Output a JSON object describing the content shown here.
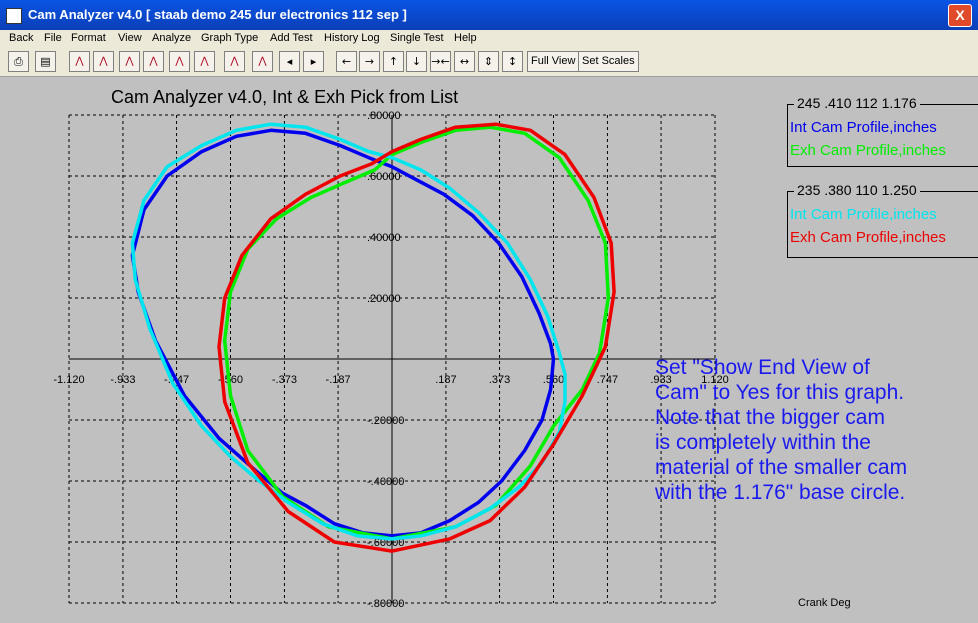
{
  "window": {
    "title": "Cam Analyzer v4.0  [ staab demo 245 dur electronics 112 sep ]",
    "close_glyph": "X"
  },
  "menu": [
    "Back",
    "File",
    "Format",
    "View",
    "Analyze",
    "Graph Type",
    "Add Test",
    "History Log",
    "Single Test",
    "Help"
  ],
  "toolbar": {
    "icon_buttons": [
      {
        "name": "print-icon",
        "glyph": "⎙"
      },
      {
        "name": "save-icon",
        "glyph": "▤"
      },
      {
        "name": "graph-icon",
        "glyph": "⋀"
      },
      {
        "name": "graph-icon",
        "glyph": "⋀"
      },
      {
        "name": "graph-icon",
        "glyph": "⋀"
      },
      {
        "name": "graph-icon",
        "glyph": "⋀"
      },
      {
        "name": "graph-icon",
        "glyph": "⋀"
      },
      {
        "name": "graph-icon",
        "glyph": "⋀"
      },
      {
        "name": "graph-icon",
        "glyph": "⋀"
      },
      {
        "name": "graph-icon",
        "glyph": "⋀"
      },
      {
        "name": "arrow-left-icon",
        "glyph": "◂"
      },
      {
        "name": "arrow-right-icon",
        "glyph": "▸"
      },
      {
        "name": "arrow-left-icon",
        "glyph": "←"
      },
      {
        "name": "arrow-right-icon",
        "glyph": "→"
      },
      {
        "name": "arrow-up-icon",
        "glyph": "↑"
      },
      {
        "name": "arrow-down-icon",
        "glyph": "↓"
      },
      {
        "name": "compress-horizontal-icon",
        "glyph": "→←"
      },
      {
        "name": "expand-horizontal-icon",
        "glyph": "↔"
      },
      {
        "name": "compress-vertical-icon",
        "glyph": "⇕"
      },
      {
        "name": "expand-vertical-icon",
        "glyph": "↕"
      }
    ],
    "full_view_label": "Full View",
    "set_scales_label": "Set Scales"
  },
  "graph": {
    "title": "Cam Analyzer v4.0,   Int & Exh Pick from List",
    "x_label": "Crank Deg",
    "note": "Set \"Show End View of\nCam\" to Yes for this graph.\nNote that the bigger cam\nis completely within the\nmaterial of the smaller cam\nwith the 1.176\" base circle."
  },
  "legends": [
    {
      "title": "245 .410 112 1.176",
      "entries": [
        {
          "label": "Int Cam Profile,inches",
          "color": "#0000ee"
        },
        {
          "label": "Exh Cam Profile,inches",
          "color": "#00ee00"
        }
      ]
    },
    {
      "title": "235 .380 110 1.250",
      "entries": [
        {
          "label": "Int Cam Profile,inches",
          "color": "#00e5ee"
        },
        {
          "label": "Exh Cam Profile,inches",
          "color": "#ee0000"
        }
      ]
    }
  ],
  "chart_data": {
    "type": "line",
    "title": "Cam Analyzer v4.0,   Int & Exh Pick from List",
    "xlabel": "Crank Deg",
    "ylabel": "",
    "x_ticks": [
      "-1.120",
      "-.933",
      "-.747",
      "-.560",
      "-.373",
      "-.187",
      ".187",
      ".373",
      ".560",
      ".747",
      ".933",
      "1.120"
    ],
    "y_ticks": [
      ".80000",
      ".60000",
      ".40000",
      ".20000",
      "-.20000",
      "-.40000",
      "-.60000",
      "-.80000"
    ],
    "xlim": [
      -1.12,
      1.12
    ],
    "ylim": [
      -0.8,
      0.8
    ],
    "grid": true,
    "series": [
      {
        "name": "Int Cam Profile,inches",
        "legend": 0,
        "color": "#0000ee",
        "x": [
          0.0,
          0.08,
          0.18,
          0.28,
          0.37,
          0.45,
          0.51,
          0.55,
          0.56,
          0.55,
          0.52,
          0.46,
          0.38,
          0.3,
          0.2,
          0.1,
          0.0,
          -0.1,
          -0.2,
          -0.3,
          -0.38,
          -0.48,
          -0.6,
          -0.72,
          -0.82,
          -0.88,
          -0.9,
          -0.86,
          -0.78,
          -0.66,
          -0.54,
          -0.42,
          -0.3,
          -0.18,
          -0.08,
          0.0
        ],
        "y": [
          0.63,
          0.59,
          0.54,
          0.47,
          0.38,
          0.27,
          0.15,
          0.05,
          0.0,
          -0.1,
          -0.2,
          -0.3,
          -0.4,
          -0.47,
          -0.53,
          -0.57,
          -0.58,
          -0.57,
          -0.54,
          -0.48,
          -0.44,
          -0.36,
          -0.26,
          -0.12,
          0.06,
          0.22,
          0.34,
          0.49,
          0.6,
          0.68,
          0.73,
          0.75,
          0.74,
          0.7,
          0.66,
          0.63
        ]
      },
      {
        "name": "Exh Cam Profile,inches",
        "legend": 0,
        "color": "#00ee00",
        "x": [
          0.0,
          0.1,
          0.22,
          0.34,
          0.46,
          0.58,
          0.68,
          0.74,
          0.75,
          0.72,
          0.66,
          0.56,
          0.48,
          0.36,
          0.22,
          0.0,
          -0.22,
          -0.38,
          -0.5,
          -0.56,
          -0.58,
          -0.56,
          -0.5,
          -0.4,
          -0.28,
          -0.16,
          -0.06,
          0.0
        ],
        "y": [
          0.67,
          0.71,
          0.75,
          0.76,
          0.74,
          0.66,
          0.52,
          0.38,
          0.2,
          0.02,
          -0.1,
          -0.22,
          -0.35,
          -0.48,
          -0.55,
          -0.59,
          -0.55,
          -0.45,
          -0.3,
          -0.12,
          0.06,
          0.22,
          0.36,
          0.46,
          0.53,
          0.58,
          0.62,
          0.67
        ]
      },
      {
        "name": "Int Cam Profile,inches",
        "legend": 1,
        "color": "#00e5ee",
        "x": [
          0.0,
          0.1,
          0.2,
          0.3,
          0.4,
          0.48,
          0.54,
          0.58,
          0.6,
          0.6,
          0.58,
          0.52,
          0.44,
          0.34,
          0.22,
          0.1,
          0.0,
          -0.12,
          -0.24,
          -0.36,
          -0.46,
          -0.56,
          -0.66,
          -0.76,
          -0.84,
          -0.89,
          -0.9,
          -0.86,
          -0.78,
          -0.66,
          -0.54,
          -0.42,
          -0.3,
          -0.18,
          -0.08,
          0.0
        ],
        "y": [
          0.66,
          0.62,
          0.56,
          0.48,
          0.38,
          0.26,
          0.14,
          0.02,
          -0.05,
          -0.14,
          -0.24,
          -0.34,
          -0.42,
          -0.49,
          -0.55,
          -0.58,
          -0.59,
          -0.58,
          -0.54,
          -0.47,
          -0.4,
          -0.32,
          -0.22,
          -0.08,
          0.1,
          0.26,
          0.38,
          0.52,
          0.63,
          0.7,
          0.75,
          0.77,
          0.76,
          0.72,
          0.68,
          0.66
        ]
      },
      {
        "name": "Exh Cam Profile,inches",
        "legend": 1,
        "color": "#ee0000",
        "x": [
          0.0,
          0.1,
          0.22,
          0.36,
          0.48,
          0.6,
          0.7,
          0.76,
          0.77,
          0.74,
          0.66,
          0.56,
          0.46,
          0.34,
          0.2,
          0.0,
          -0.2,
          -0.36,
          -0.5,
          -0.58,
          -0.6,
          -0.58,
          -0.52,
          -0.42,
          -0.3,
          -0.18,
          -0.07,
          0.0
        ],
        "y": [
          0.68,
          0.72,
          0.76,
          0.77,
          0.75,
          0.67,
          0.53,
          0.38,
          0.22,
          0.04,
          -0.12,
          -0.28,
          -0.42,
          -0.53,
          -0.59,
          -0.63,
          -0.6,
          -0.5,
          -0.34,
          -0.14,
          0.04,
          0.2,
          0.34,
          0.46,
          0.54,
          0.6,
          0.64,
          0.68
        ]
      }
    ]
  }
}
